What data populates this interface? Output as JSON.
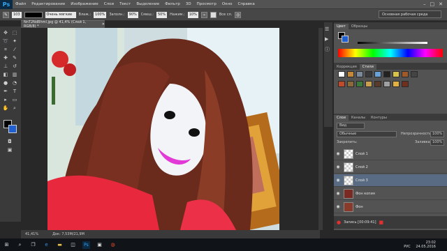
{
  "menu": {
    "logo": "Ps",
    "items": [
      "Файл",
      "Редактирование",
      "Изображение",
      "Слои",
      "Текст",
      "Выделение",
      "Фильтр",
      "3D",
      "Просмотр",
      "Окно",
      "Справка"
    ],
    "window_controls": [
      "–",
      "□",
      "✕"
    ]
  },
  "options": {
    "size": "103",
    "mode": "Очень мягкие",
    "opacity_label": "Влаж.:",
    "opacity": "100%",
    "fill_label": "Заполн.:",
    "fill": "90%",
    "mix_label": "Смеш.:",
    "mix": "50%",
    "flow_label": "Нажим.:",
    "flow": "10%",
    "all_layers": "Все сл."
  },
  "workspace": "Основная рабочая среда",
  "document": {
    "tab": "NnT2NdBhml.jpg @ 41,4% (Слой 1, RGB/8) *",
    "close": "✕"
  },
  "status": {
    "zoom": "41,41%",
    "doc": "Док: 7,53М/21,9М"
  },
  "color_panel": {
    "tabs": [
      "Цвет",
      "Образцы"
    ]
  },
  "adjust_panel": {
    "tabs": [
      "Коррекция",
      "Стили"
    ]
  },
  "layers_panel": {
    "tabs": [
      "Слои",
      "Каналы",
      "Контуры"
    ],
    "kind": "Вид",
    "blend": "Обычные",
    "opacity_label": "Непрозрачность:",
    "opacity": "100%",
    "lock_label": "Закрепить:",
    "fill_label": "Заливка:",
    "fill": "100%",
    "layers": [
      {
        "name": "Слой 1"
      },
      {
        "name": "Слой 2"
      },
      {
        "name": "Слой 3"
      },
      {
        "name": "Фон копия"
      },
      {
        "name": "Фон"
      }
    ]
  },
  "timeline": {
    "label": "Запись [00:09:41]"
  },
  "taskbar": {
    "lang": "РУС",
    "time": "23:02",
    "date": "24.05.2016"
  },
  "colors": {
    "accent": "#3f7fd8",
    "selected_layer": "#596b82",
    "foreground": "#000000",
    "background": "#1f5fd0"
  }
}
